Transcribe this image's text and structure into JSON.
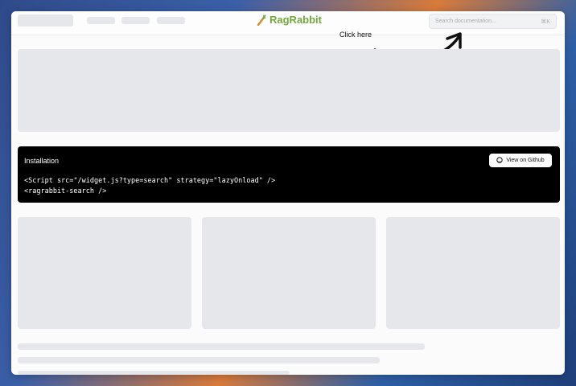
{
  "header": {
    "brand": "RagRabbit",
    "search_placeholder": "Search documentation...",
    "search_shortcut": "⌘K"
  },
  "annotation": {
    "hint": "Click here"
  },
  "installation": {
    "title": "Installation",
    "github_button": "View on Github",
    "code_line_1": "<Script src=\"/widget.js?type=search\" strategy=\"lazyOnload\" />",
    "code_line_2": "<ragrabbit-search />"
  },
  "colors": {
    "brand": "#73a83c",
    "code_bg": "#000000",
    "skeleton": "#e5e7ea"
  }
}
